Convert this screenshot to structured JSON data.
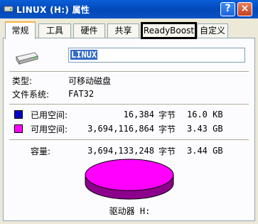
{
  "window": {
    "title": "LINUX (H:) 属性",
    "help_label": "?",
    "close_label": "×"
  },
  "tabs": [
    {
      "label": "常规"
    },
    {
      "label": "工具"
    },
    {
      "label": "硬件"
    },
    {
      "label": "共享"
    },
    {
      "label": "ReadyBoost"
    },
    {
      "label": "自定义"
    }
  ],
  "general": {
    "volume_label": "LINUX",
    "type_label": "类型:",
    "type_value": "可移动磁盘",
    "fs_label": "文件系统:",
    "fs_value": "FAT32",
    "used": {
      "label": "已用空间:",
      "bytes": "16,384",
      "unit": "字节",
      "size": "16.0 KB",
      "color": "#0000c8"
    },
    "free": {
      "label": "可用空间:",
      "bytes": "3,694,116,864",
      "unit": "字节",
      "size": "3.43 GB",
      "color": "#ff00ff"
    },
    "capacity": {
      "label": "容量:",
      "bytes": "3,694,133,248",
      "unit": "字节",
      "size": "3.44 GB"
    },
    "drive_caption": "驱动器 H:"
  }
}
